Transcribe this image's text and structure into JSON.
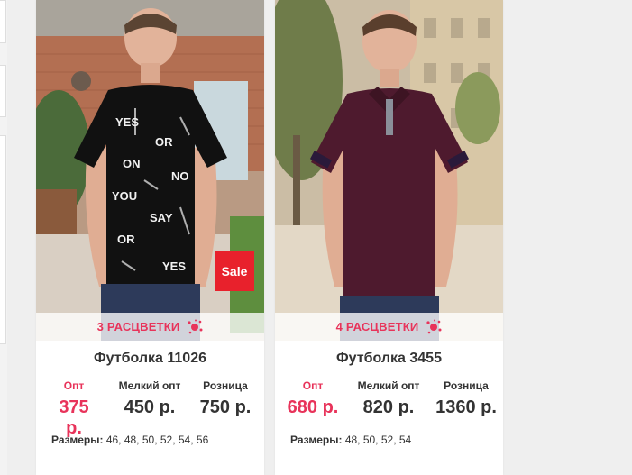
{
  "products": [
    {
      "title": "Футболка 11026",
      "colors_label": "3 РАСЦВЕТКИ",
      "sale_label": "Sale",
      "prices": [
        {
          "label": "Опт",
          "value": "375 р."
        },
        {
          "label": "Мелкий опт",
          "value": "450 р."
        },
        {
          "label": "Розница",
          "value": "750 р."
        }
      ],
      "sizes_label": "Размеры:",
      "sizes_value": "46, 48, 50, 52, 54, 56",
      "shirt_print_words": [
        "YES",
        "NO",
        "OR",
        "SAY",
        "YOU"
      ]
    },
    {
      "title": "Футболка 3455",
      "colors_label": "4 РАСЦВЕТКИ",
      "prices": [
        {
          "label": "Опт",
          "value": "680 р."
        },
        {
          "label": "Мелкий опт",
          "value": "820 р."
        },
        {
          "label": "Розница",
          "value": "1360 р."
        }
      ],
      "sizes_label": "Размеры:",
      "sizes_value": "48, 50, 52, 54"
    }
  ],
  "theme": {
    "accent": "#e8335a",
    "sale": "#e8212c",
    "text": "#333333",
    "shirt1": "#111111",
    "shirt2": "#4e1a2e"
  }
}
